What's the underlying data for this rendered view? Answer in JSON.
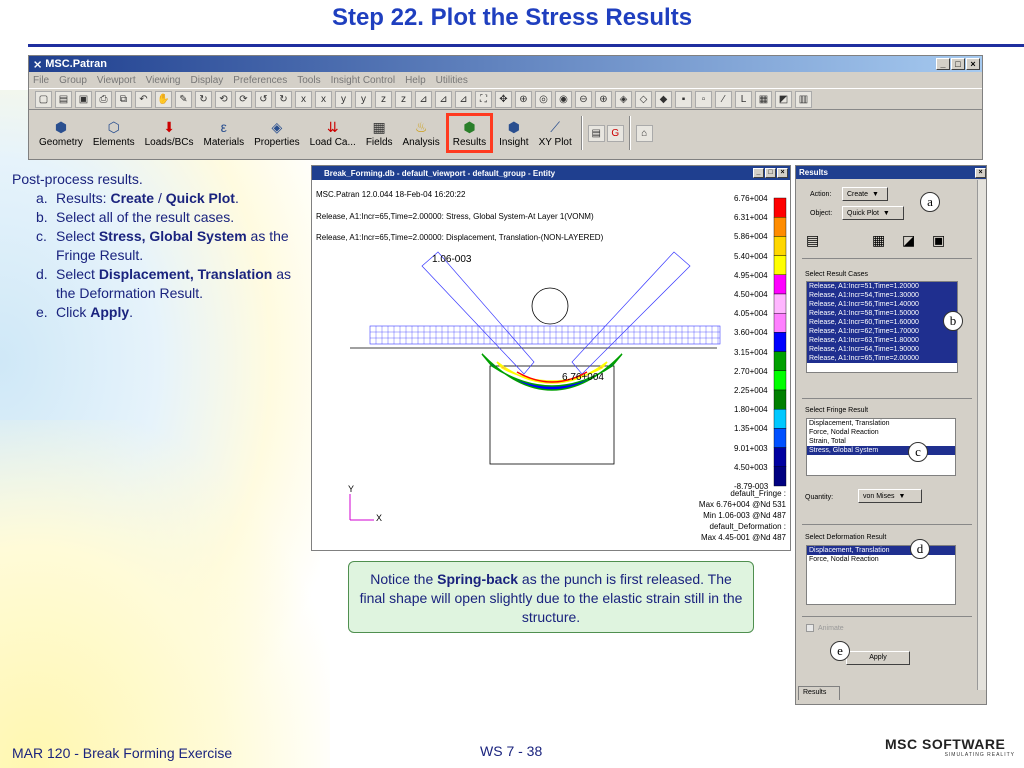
{
  "slide": {
    "title": "Step 22. Plot the Stress Results",
    "footer_left": "MAR 120 - Break Forming Exercise",
    "footer_center": "WS 7 - 38",
    "logo_text": "MSC SOFTWARE",
    "logo_tagline": "SIMULATING REALITY"
  },
  "patran": {
    "title": "MSC.Patran",
    "menu": [
      "File",
      "Group",
      "Viewport",
      "Viewing",
      "Display",
      "Preferences",
      "Tools",
      "Insight Control",
      "Help",
      "Utilities"
    ],
    "apps": [
      {
        "label": "Geometry"
      },
      {
        "label": "Elements"
      },
      {
        "label": "Loads/BCs"
      },
      {
        "label": "Materials"
      },
      {
        "label": "Properties"
      },
      {
        "label": "Load Ca..."
      },
      {
        "label": "Fields"
      },
      {
        "label": "Analysis"
      },
      {
        "label": "Results"
      },
      {
        "label": "Insight"
      },
      {
        "label": "XY Plot"
      }
    ]
  },
  "instructions": {
    "intro": "Post-process results.",
    "a_prefix": "Results: ",
    "a_b1": "Create",
    "a_mid": " / ",
    "a_b2": "Quick Plot",
    "a_end": ".",
    "b": "Select all of the result cases.",
    "c_prefix": "Select ",
    "c_bold": "Stress, Global System",
    "c_end": " as the Fringe Result.",
    "d_prefix": "Select ",
    "d_bold": "Displacement, Translation",
    "d_end": " as the Deformation Result.",
    "e_prefix": "Click ",
    "e_bold": "Apply",
    "e_end": "."
  },
  "viewport": {
    "title": "Break_Forming.db - default_viewport - default_group - Entity",
    "line1": "MSC.Patran 12.0.044 18-Feb-04 16:20:22",
    "line2": "Release, A1:Incr=65,Time=2.00000: Stress, Global System-At Layer 1(VONM)",
    "line3": "Release, A1:Incr=65,Time=2.00000: Displacement, Translation-(NON-LAYERED)",
    "label_top": "1.06-003",
    "label_center": "6.76+004",
    "legend_values": [
      "6.76+004",
      "6.31+004",
      "5.86+004",
      "5.40+004",
      "4.95+004",
      "4.50+004",
      "4.05+004",
      "3.60+004",
      "3.15+004",
      "2.70+004",
      "2.25+004",
      "1.80+004",
      "1.35+004",
      "9.01+003",
      "4.50+003",
      "-8.79-003"
    ],
    "legend_colors": [
      "#ff0000",
      "#ff8c00",
      "#ffd700",
      "#ffff00",
      "#ff00ff",
      "#ffb6ff",
      "#ff80ff",
      "#0000ff",
      "#00a000",
      "#00ff00",
      "#008000",
      "#00c8ff",
      "#0050ff",
      "#0000a0",
      "#000080",
      "#ffffff"
    ],
    "summary": [
      "default_Fringe :",
      "Max 6.76+004 @Nd 531",
      "Min 1.06-003 @Nd 487",
      "default_Deformation :",
      "Max 4.45-001 @Nd 487"
    ],
    "axis_y": "Y",
    "axis_x": "X"
  },
  "results_panel": {
    "title": "Results",
    "action_label": "Action:",
    "action_value": "Create",
    "object_label": "Object:",
    "object_value": "Quick Plot",
    "cases_label": "Select Result Cases",
    "cases": [
      "Release, A1:Incr=51,Time=1.20000",
      "Release, A1:Incr=54,Time=1.30000",
      "Release, A1:Incr=56,Time=1.40000",
      "Release, A1:Incr=58,Time=1.50000",
      "Release, A1:Incr=60,Time=1.60000",
      "Release, A1:Incr=62,Time=1.70000",
      "Release, A1:Incr=63,Time=1.80000",
      "Release, A1:Incr=64,Time=1.90000",
      "Release, A1:Incr=65,Time=2.00000"
    ],
    "fringe_label": "Select Fringe Result",
    "fringe_items": [
      "Displacement, Translation",
      "Force, Nodal Reaction",
      "Strain, Total",
      "Stress, Global System"
    ],
    "quantity_label": "Quantity:",
    "quantity_value": "von Mises",
    "deform_label": "Select Deformation Result",
    "deform_items": [
      "Displacement, Translation",
      "Force, Nodal Reaction"
    ],
    "animate_label": "Animate",
    "apply_label": "Apply",
    "tab_label": "Results"
  },
  "callouts": {
    "a": "a",
    "b": "b",
    "c": "c",
    "d": "d",
    "e": "e"
  },
  "note": {
    "p1": "Notice the ",
    "bold": "Spring-back",
    "p2": " as the punch is first released.  The final shape will open slightly due to the elastic strain still in the structure."
  }
}
